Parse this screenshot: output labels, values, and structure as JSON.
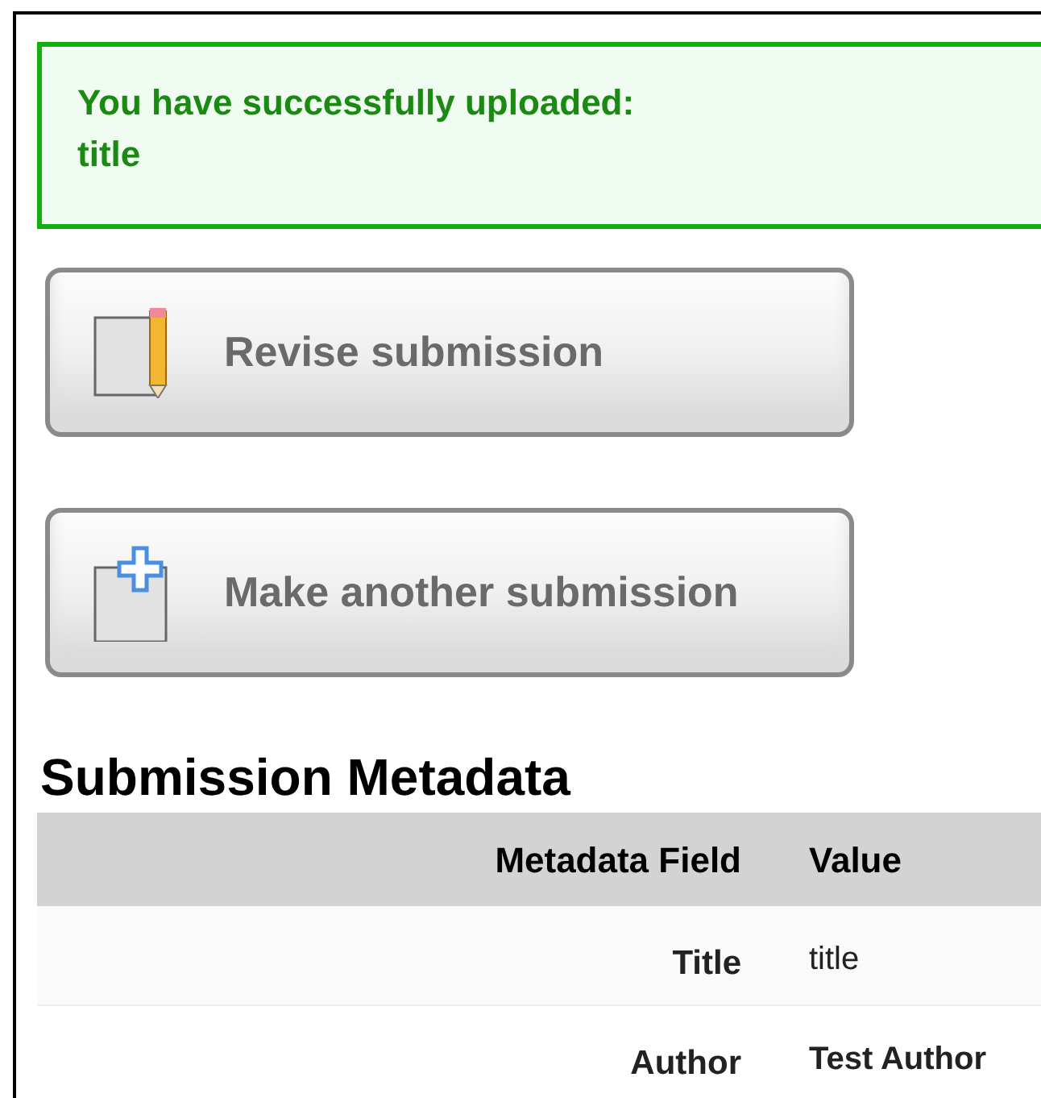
{
  "notice": {
    "lines": [
      "You have successfully uploaded:",
      "title"
    ]
  },
  "actions": [
    {
      "label": "Revise submission",
      "kind": "revise"
    },
    {
      "label": "Make another submission",
      "kind": "new"
    }
  ],
  "metadata": {
    "heading": "Submission Metadata",
    "columns": [
      "Metadata Field",
      "Value"
    ],
    "rows": [
      {
        "field": "Title",
        "value": "title",
        "bold": false
      },
      {
        "field": "Author",
        "value": "Test Author",
        "bold": true
      }
    ]
  }
}
